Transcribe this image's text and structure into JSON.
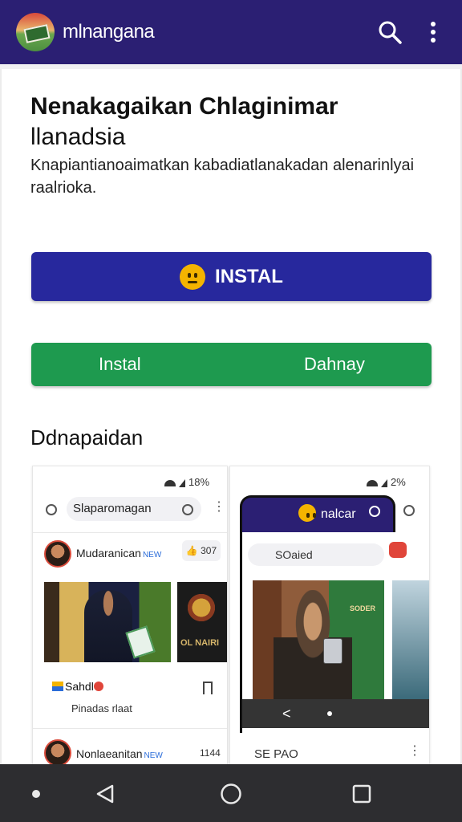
{
  "appbar": {
    "title": "mlnangana",
    "icons": [
      "app-logo-icon",
      "search-icon",
      "more-vert-icon"
    ],
    "color": "#2b1f73"
  },
  "header": {
    "heading_line1": "Nenakagaikan Chlaginimar",
    "heading_line2": "llanadsia",
    "description": "Knapiantianoaimatkan kabadiatlanakadan alenarinlyai raalrioka."
  },
  "buttons": {
    "primary_label": "INSTAL",
    "primary_color": "#27289d",
    "secondary_left": "Instal",
    "secondary_right": "Dahnay",
    "secondary_color": "#1e9a4f"
  },
  "section": {
    "title": "Ddnapaidan"
  },
  "screenshot1": {
    "status": "18%",
    "search_text": "Slaparomagan",
    "post1_user": "Mudaranican",
    "post1_tag": "NEW",
    "post1_likes": "307",
    "photo_text": "OL NAIRI",
    "caption": "Sahdl",
    "subcaption": "Pinadas rlaat",
    "post2_user": "Nonlaeanitan",
    "post2_tag": "NEW",
    "post2_meta": "1144"
  },
  "screenshot2": {
    "status": "2%",
    "app_title": "nalcar",
    "search_text": "SOaied",
    "sign_text": "SODER",
    "footer_text": "SE PAO"
  }
}
